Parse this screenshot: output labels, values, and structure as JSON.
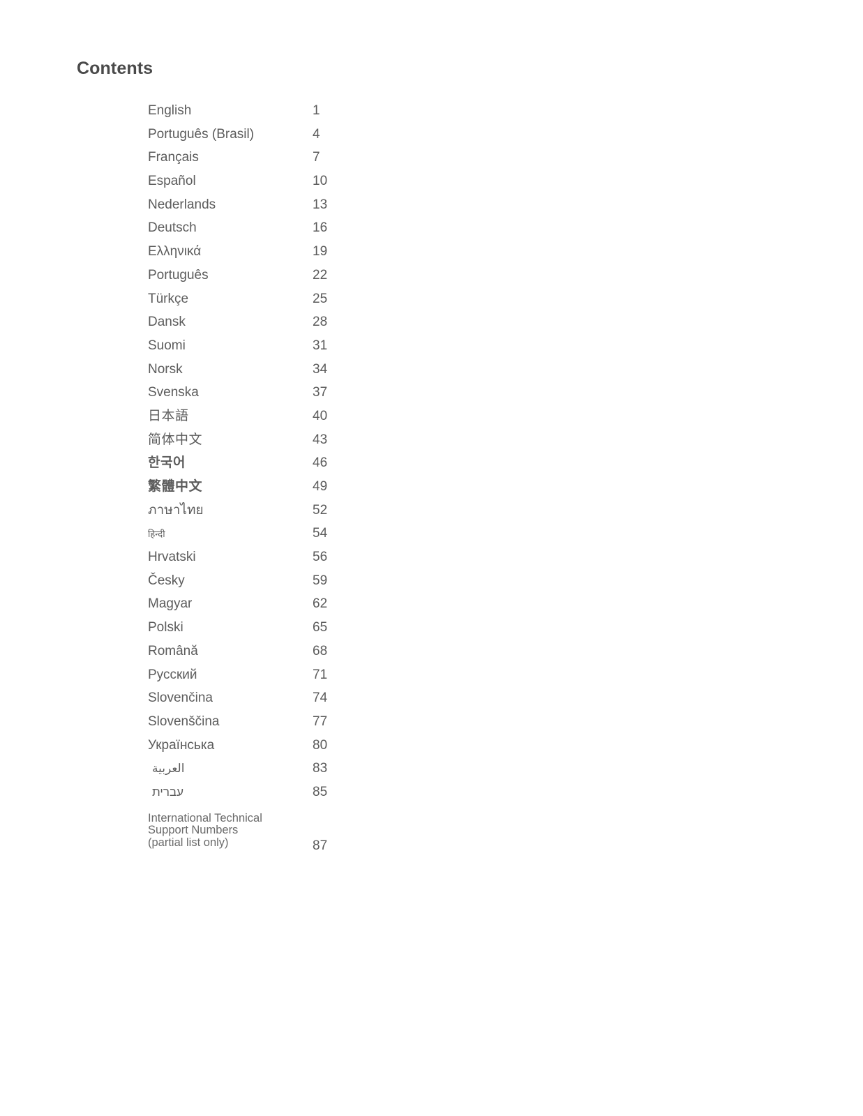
{
  "document": {
    "title": "Contents"
  },
  "toc": {
    "entries": [
      {
        "label": "English",
        "page": "1",
        "script": "latin"
      },
      {
        "label": "Português (Brasil)",
        "page": "4",
        "script": "latin"
      },
      {
        "label": "Français",
        "page": "7",
        "script": "latin"
      },
      {
        "label": "Español",
        "page": "10",
        "script": "latin"
      },
      {
        "label": "Nederlands",
        "page": "13",
        "script": "latin"
      },
      {
        "label": "Deutsch",
        "page": "16",
        "script": "latin"
      },
      {
        "label": "Ελληνικά",
        "page": "19",
        "script": "greek"
      },
      {
        "label": "Português",
        "page": "22",
        "script": "latin"
      },
      {
        "label": "Türkçe",
        "page": "25",
        "script": "latin"
      },
      {
        "label": "Dansk",
        "page": "28",
        "script": "latin"
      },
      {
        "label": "Suomi",
        "page": "31",
        "script": "latin"
      },
      {
        "label": "Norsk",
        "page": "34",
        "script": "latin"
      },
      {
        "label": "Svenska",
        "page": "37",
        "script": "latin"
      },
      {
        "label": "日本語",
        "page": "40",
        "script": "jp"
      },
      {
        "label": "简体中文",
        "page": "43",
        "script": "zh"
      },
      {
        "label": "한국어",
        "page": "46",
        "script": "korean"
      },
      {
        "label": "繁體中文",
        "page": "49",
        "script": "trad-chinese"
      },
      {
        "label": "ภาษาไทย",
        "page": "52",
        "script": "thai"
      },
      {
        "label": "हिन्दी",
        "page": "54",
        "script": "hindi"
      },
      {
        "label": "Hrvatski",
        "page": "56",
        "script": "latin"
      },
      {
        "label": "Česky",
        "page": "59",
        "script": "latin"
      },
      {
        "label": "Magyar",
        "page": "62",
        "script": "latin"
      },
      {
        "label": "Polski",
        "page": "65",
        "script": "latin"
      },
      {
        "label": "Română",
        "page": "68",
        "script": "latin"
      },
      {
        "label": "Русский",
        "page": "71",
        "script": "cyrillic"
      },
      {
        "label": "Slovenčina",
        "page": "74",
        "script": "latin"
      },
      {
        "label": "Slovenščina",
        "page": "77",
        "script": "latin"
      },
      {
        "label": "Українська",
        "page": "80",
        "script": "cyrillic"
      },
      {
        "label": "العربية",
        "page": "83",
        "script": "rtl"
      },
      {
        "label": "עברית",
        "page": "85",
        "script": "rtl"
      },
      {
        "label": "International Technical\nSupport Numbers\n(partial list only)",
        "page": "87",
        "script": "latin-multiline"
      }
    ]
  }
}
